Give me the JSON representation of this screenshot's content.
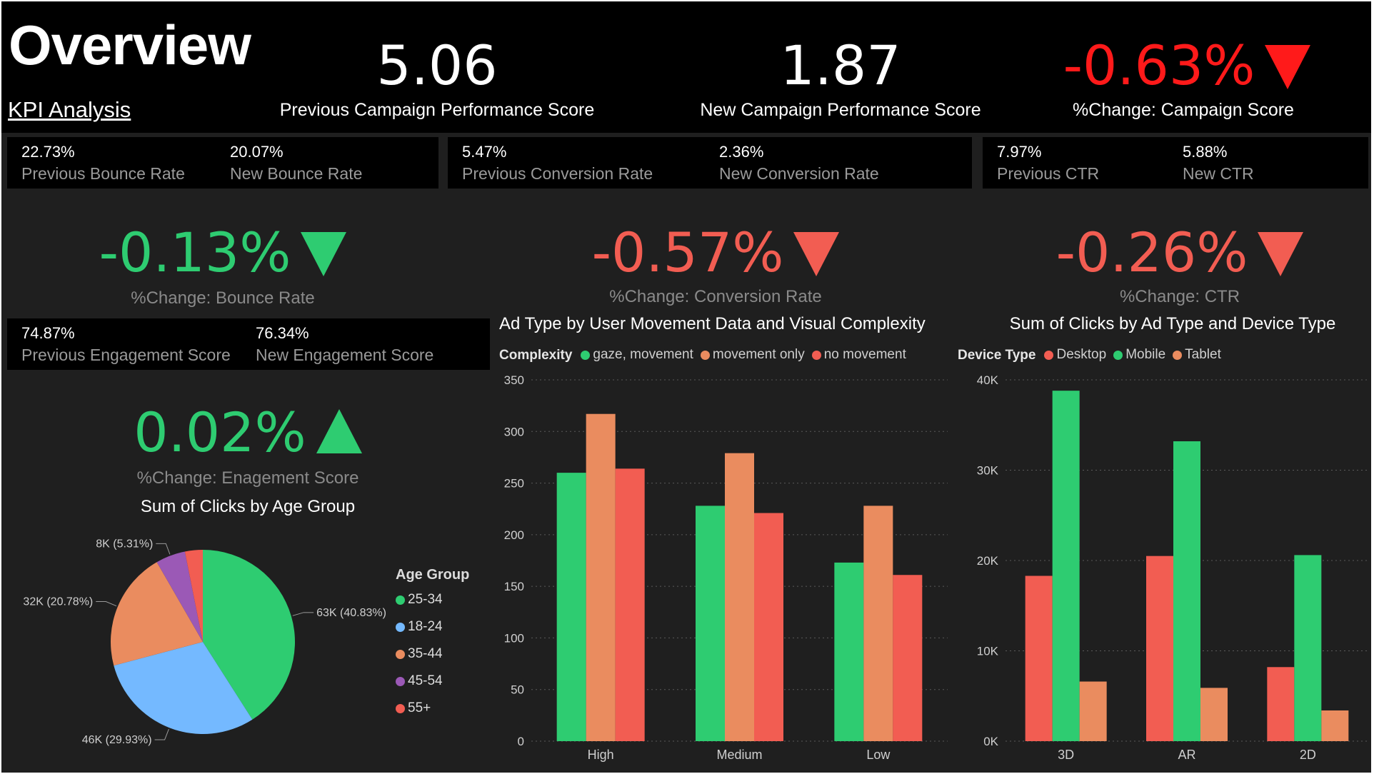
{
  "header": {
    "title": "Overview",
    "subtitle": "KPI Analysis",
    "prev_score": {
      "value": "5.06",
      "label": "Previous Campaign Performance Score"
    },
    "new_score": {
      "value": "1.87",
      "label": "New Campaign Performance Score"
    },
    "change_score": {
      "value": "-0.63%",
      "label": "%Change: Campaign Score",
      "direction": "down",
      "color": "#ff1a1a"
    }
  },
  "rates": {
    "bounce": {
      "prev_value": "22.73%",
      "prev_label": "Previous Bounce Rate",
      "new_value": "20.07%",
      "new_label": "New Bounce Rate"
    },
    "conversion": {
      "prev_value": "5.47%",
      "prev_label": "Previous Conversion Rate",
      "new_value": "2.36%",
      "new_label": "New Conversion Rate"
    },
    "ctr": {
      "prev_value": "7.97%",
      "prev_label": "Previous CTR",
      "new_value": "5.88%",
      "new_label": "New CTR"
    },
    "engagement": {
      "prev_value": "74.87%",
      "prev_label": "Previous Engagement Score",
      "new_value": "76.34%",
      "new_label": "New Engagement Score"
    }
  },
  "kpis": {
    "bounce_change": {
      "value": "-0.13%",
      "label": "%Change: Bounce Rate",
      "direction": "down",
      "color": "#2ecc71"
    },
    "conversion_change": {
      "value": "-0.57%",
      "label": "%Change: Conversion Rate",
      "direction": "down",
      "color": "#f25d52"
    },
    "ctr_change": {
      "value": "-0.26%",
      "label": "%Change: CTR",
      "direction": "down",
      "color": "#f25d52"
    },
    "engagement_change": {
      "value": "0.02%",
      "label": "%Change: Enagement Score",
      "direction": "up",
      "color": "#2ecc71"
    }
  },
  "chart_data": [
    {
      "type": "pie",
      "title": "Sum of Clicks by Age Group",
      "legend_title": "Age Group",
      "legend_position": "right",
      "slices": [
        {
          "name": "25-34",
          "value": 63000,
          "label": "63K (40.83%)",
          "color": "#2ecc71"
        },
        {
          "name": "18-24",
          "value": 46000,
          "label": "46K (29.93%)",
          "color": "#74b9ff"
        },
        {
          "name": "35-44",
          "value": 32000,
          "label": "32K (20.78%)",
          "color": "#ea8c5f"
        },
        {
          "name": "45-54",
          "value": 8000,
          "label": "8K (5.31%)",
          "color": "#9b59b6"
        },
        {
          "name": "55+",
          "value": 4800,
          "label": "",
          "color": "#f25d52"
        }
      ]
    },
    {
      "type": "bar",
      "title": "Ad Type by User Movement Data and Visual Complexity",
      "legend_title": "Complexity",
      "legend_position": "top-left",
      "categories": [
        "High",
        "Medium",
        "Low"
      ],
      "ylim": [
        0,
        350
      ],
      "yticks": [
        0,
        50,
        100,
        150,
        200,
        250,
        300,
        350
      ],
      "ytick_labels": [
        "0",
        "50",
        "100",
        "150",
        "200",
        "250",
        "300",
        "350"
      ],
      "grid": true,
      "series": [
        {
          "name": "gaze, movement",
          "color": "#2ecc71",
          "values": [
            260,
            228,
            173
          ]
        },
        {
          "name": "movement only",
          "color": "#ea8c5f",
          "values": [
            317,
            279,
            228
          ]
        },
        {
          "name": "no movement",
          "color": "#f25d52",
          "values": [
            264,
            221,
            161
          ]
        }
      ]
    },
    {
      "type": "bar",
      "title": "Sum of Clicks by Ad Type and Device Type",
      "legend_title": "Device Type",
      "legend_position": "top-left",
      "categories": [
        "3D",
        "AR",
        "2D"
      ],
      "ylim": [
        0,
        40000
      ],
      "yticks": [
        0,
        10000,
        20000,
        30000,
        40000
      ],
      "ytick_labels": [
        "0K",
        "10K",
        "20K",
        "30K",
        "40K"
      ],
      "grid": true,
      "series": [
        {
          "name": "Desktop",
          "color": "#f25d52",
          "values": [
            18300,
            20500,
            8200
          ]
        },
        {
          "name": "Mobile",
          "color": "#2ecc71",
          "values": [
            38800,
            33200,
            20600
          ]
        },
        {
          "name": "Tablet",
          "color": "#ea8c5f",
          "values": [
            6600,
            5900,
            3400
          ]
        }
      ]
    }
  ]
}
